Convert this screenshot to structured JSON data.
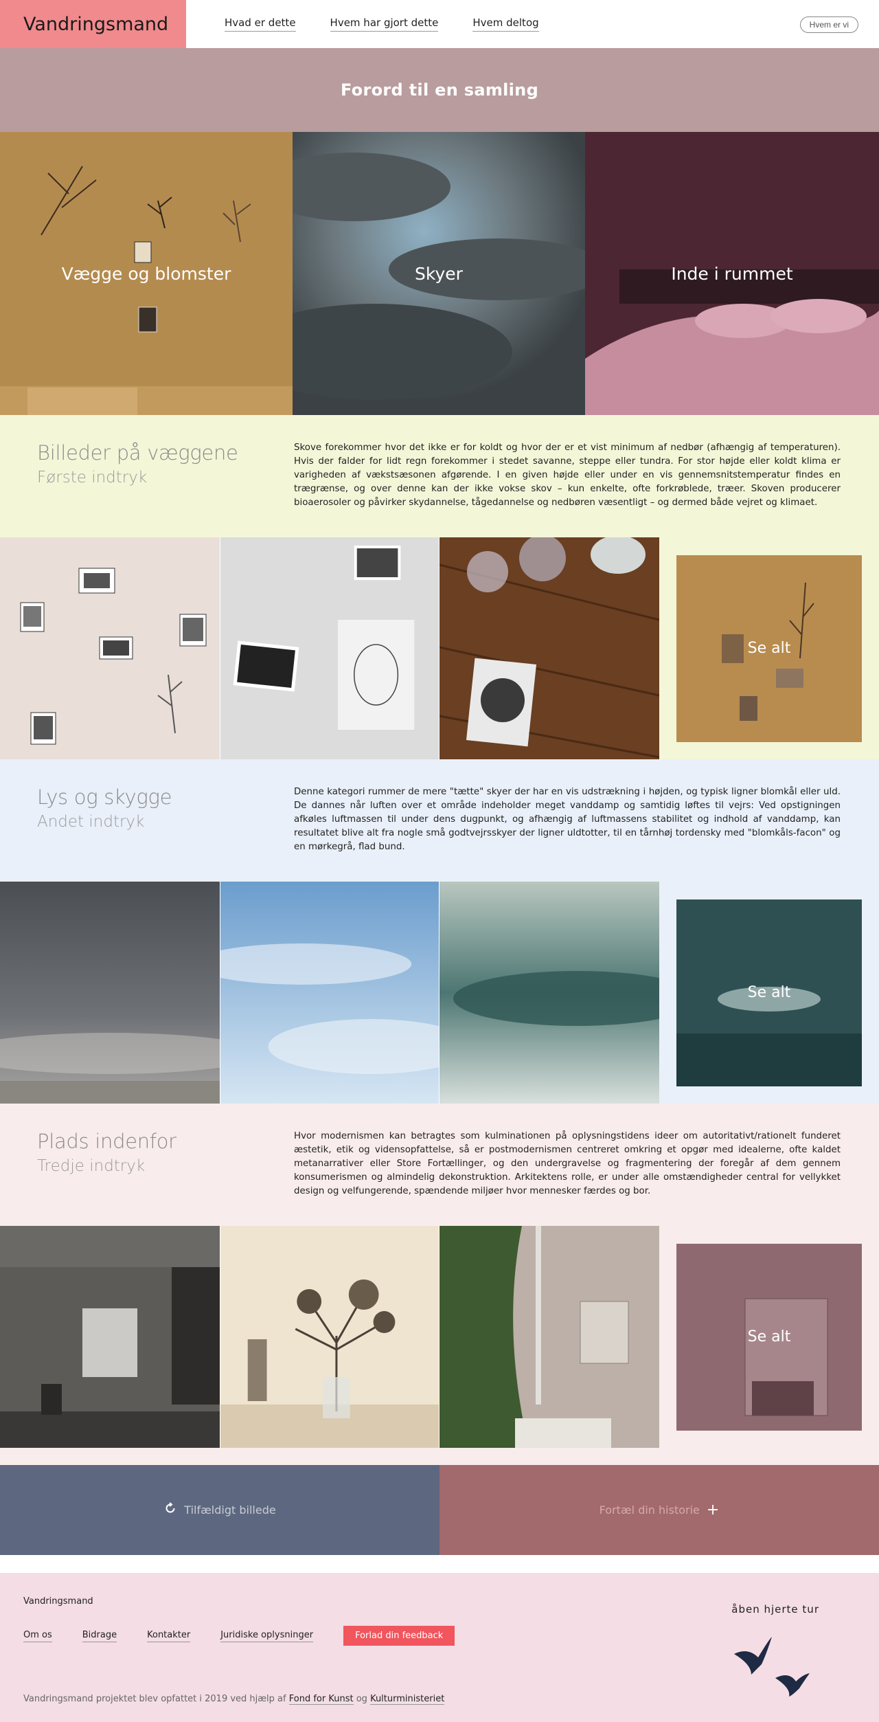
{
  "header": {
    "logo": "Vandringsmand",
    "nav": [
      "Hvad er dette",
      "Hvem har gjort dette",
      "Hvem deltog"
    ],
    "who_button": "Hvem er vi"
  },
  "hero": {
    "title": "Forord til en samling"
  },
  "categories": [
    {
      "label": "Vægge og blomster",
      "color": "#b48b4f"
    },
    {
      "label": "Skyer",
      "color": "#5b6367"
    },
    {
      "label": "Inde i rummet",
      "color": "#4c2733"
    }
  ],
  "sections": [
    {
      "title": "Billeder på væggene",
      "subtitle": "Første indtryk",
      "text": "Skove forekommer hvor det ikke er for koldt og hvor der er et vist minimum af nedbør (afhængig af temperaturen). Hvis der falder for lidt regn forekommer i stedet savanne, steppe eller tundra. For stor højde eller koldt klima er varigheden af vækstsæsonen afgørende. I en given højde eller under en vis gennemsnitstemperatur findes en trægrænse, og over denne kan der ikke vokse skov – kun enkelte, ofte forkrøblede, træer. Skoven producerer bioaerosoler og påvirker skydannelse, tågedannelse og nedbøren væsentligt – og dermed både vejret og klimaet.",
      "see_all": "Se alt",
      "background": "#f4f6d8"
    },
    {
      "title": "Lys og skygge",
      "subtitle": "Andet indtryk",
      "text": "Denne kategori rummer de mere \"tætte\" skyer der har en vis udstrækning i højden, og typisk ligner blomkål eller uld. De dannes når luften over et område indeholder meget vanddamp og samtidig løftes til vejrs: Ved opstigningen afkøles luftmassen til under dens dugpunkt, og afhængig af luftmassens stabilitet og indhold af vanddamp, kan resultatet blive alt fra nogle små godtvejrsskyer der ligner uldtotter, til en tårnhøj tordensky med \"blomkåls-facon\" og en mørkegrå, flad bund.",
      "see_all": "Se alt",
      "background": "#eaf0f9"
    },
    {
      "title": "Plads indenfor",
      "subtitle": "Tredje indtryk",
      "text": "Hvor modernismen kan betragtes som kulminationen på oplysningstidens ideer om autoritativt/rationelt funderet æstetik, etik og vidensopfattelse, så er postmodernismen centreret omkring et opgør med idealerne, ofte kaldet metanarrativer eller Store Fortællinger, og den undergravelse og fragmentering der foregår af dem gennem konsumerismen og almindelig dekonstruktion. Arkitektens rolle, er under alle omstændigheder central for vellykket design og velfungerende, spændende miljøer hvor mennesker færdes og bor.",
      "see_all": "Se alt",
      "background": "#f9ecec"
    }
  ],
  "actions": {
    "random": "Tilfældigt billede",
    "story": "Fortæl din historie",
    "random_icon": "refresh-icon",
    "story_icon": "plus-icon"
  },
  "footer": {
    "brand": "Vandringsmand",
    "links": [
      "Om os",
      "Bidrage",
      "Kontakter",
      "Juridiske oplysninger"
    ],
    "feedback": "Forlad din feedback",
    "note_prefix": "Vandringsmand projektet blev opfattet i 2019 ved hjælp af",
    "note_link1": "Fond for Kunst",
    "note_and": "og",
    "note_link2": "Kulturministeriet",
    "motto": "åben hjerte tur"
  }
}
